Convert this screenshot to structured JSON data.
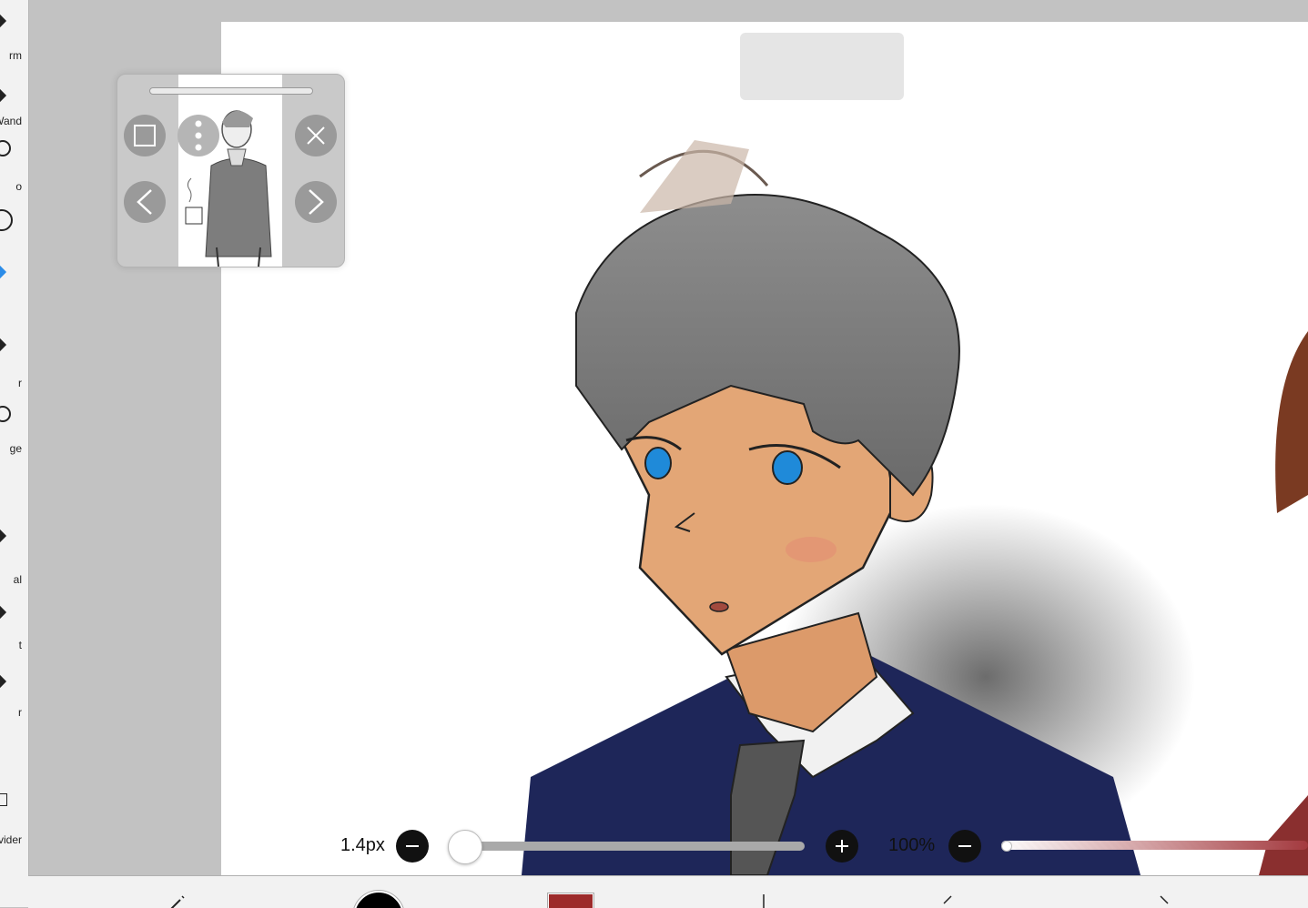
{
  "toolbar": {
    "items": [
      {
        "label": "rm",
        "icon": "transform-icon"
      },
      {
        "label": "Wand",
        "icon": "magic-wand-icon"
      },
      {
        "label": "o",
        "icon": "lasso-icon"
      },
      {
        "label": "",
        "icon": "brush-icon"
      },
      {
        "label": "",
        "icon": "fill-icon"
      },
      {
        "label": "r",
        "icon": "eraser-icon"
      },
      {
        "label": "ge",
        "icon": "smudge-icon"
      },
      {
        "label": "al",
        "icon": "filter-icon"
      },
      {
        "label": "t",
        "icon": "text-icon"
      },
      {
        "label": "r",
        "icon": "eyedropper-icon"
      },
      {
        "label": "vider",
        "icon": "frame-divider-icon"
      }
    ]
  },
  "bottom_controls": {
    "brush_size": "1.4px",
    "brush_size_fraction": 0.03,
    "opacity": "100%",
    "opacity_fraction": 1.0
  },
  "colors": {
    "primary": "#000000",
    "secondary": "#9c2a2a",
    "canvas": "#ffffff",
    "workspace": "#c2c2c2"
  }
}
